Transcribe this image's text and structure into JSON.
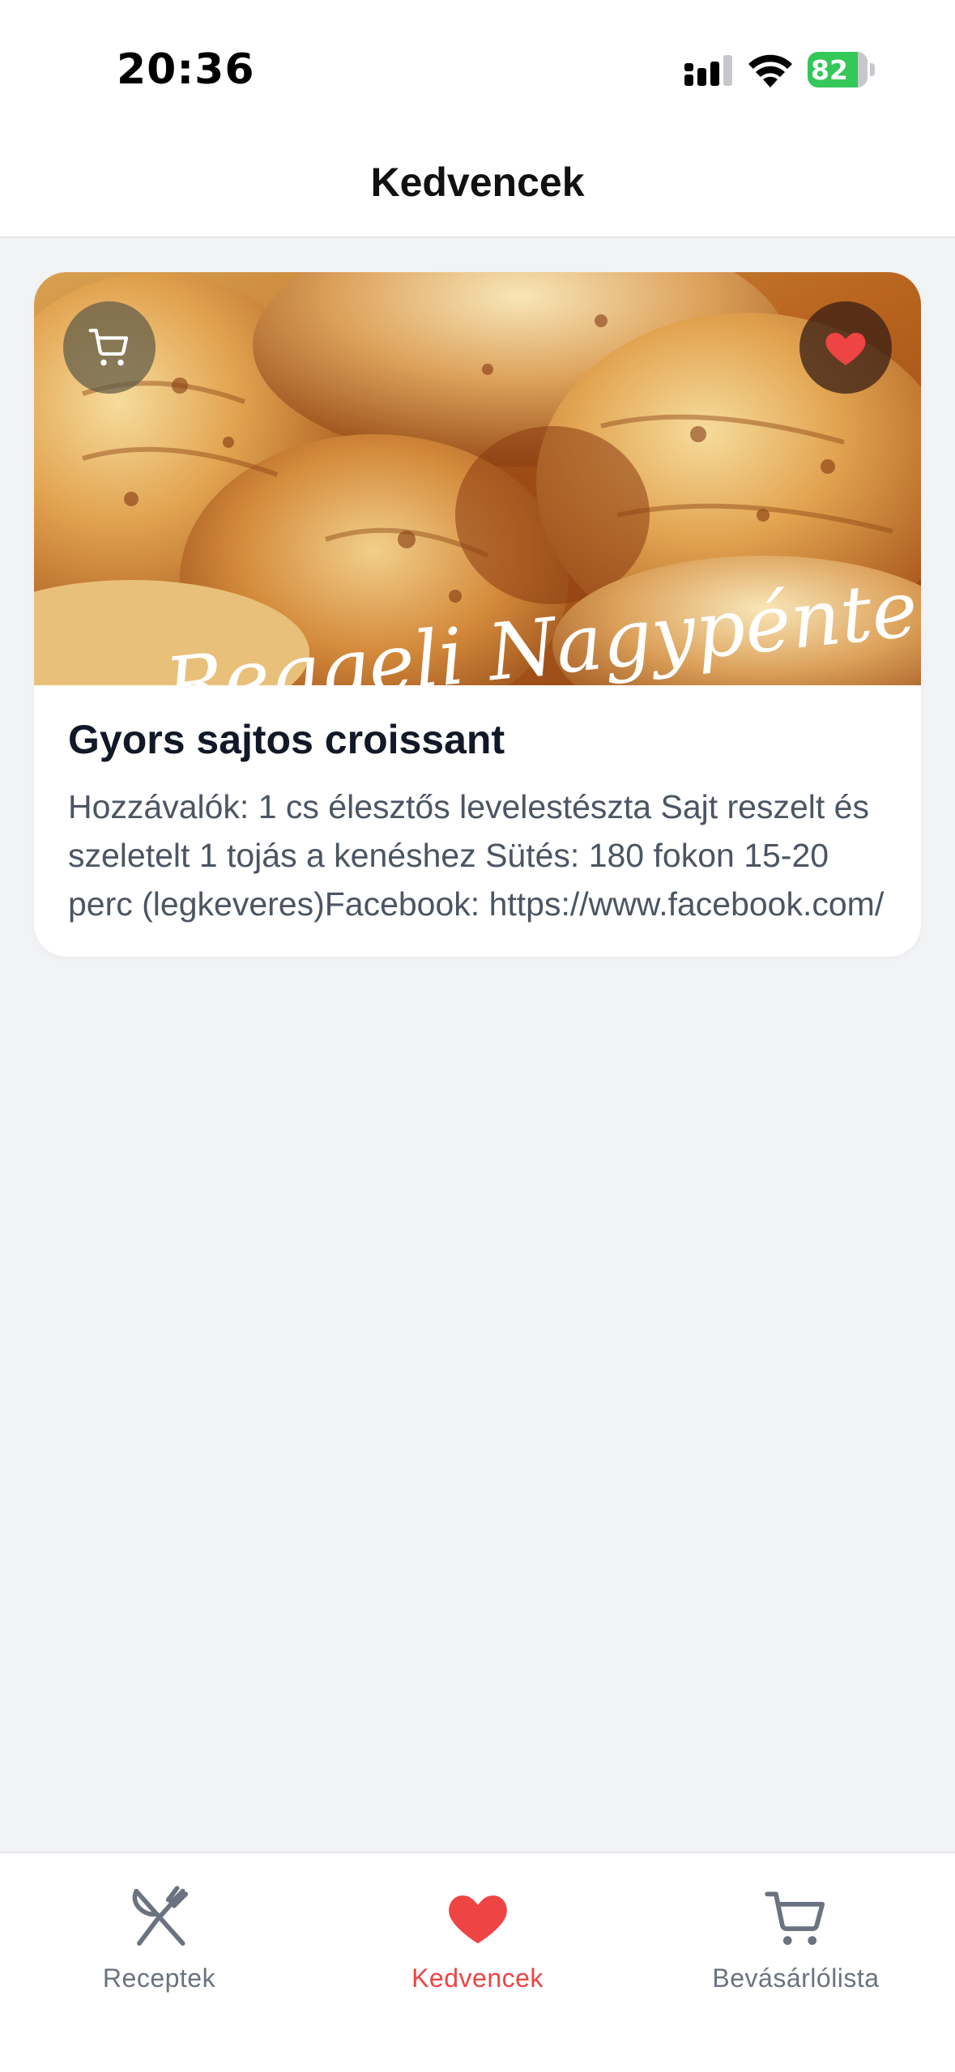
{
  "status_bar": {
    "time": "20:36",
    "battery": "82"
  },
  "nav": {
    "title": "Kedvencek"
  },
  "recipe": {
    "title": "Gyors sajtos croissant",
    "description": "Hozzávalók: 1 cs élesztős levelestészta Sajt reszelt és szeletelt 1 tojás a kenéshez Sütés: 180 fokon 15-20 perc (legkeveres)Facebook: https://www.facebook.com/",
    "image_watermark": "Reggeli Nagypénteken"
  },
  "tabs": [
    {
      "label": "Receptek",
      "icon": "fork-knife-icon",
      "active": false
    },
    {
      "label": "Kedvencek",
      "icon": "heart-icon",
      "active": true
    },
    {
      "label": "Bevásárlólista",
      "icon": "cart-icon",
      "active": false
    }
  ],
  "colors": {
    "accent": "#ef4444",
    "inactive": "#6b7280",
    "background": "#f2f3f5",
    "battery": "#34c759"
  }
}
